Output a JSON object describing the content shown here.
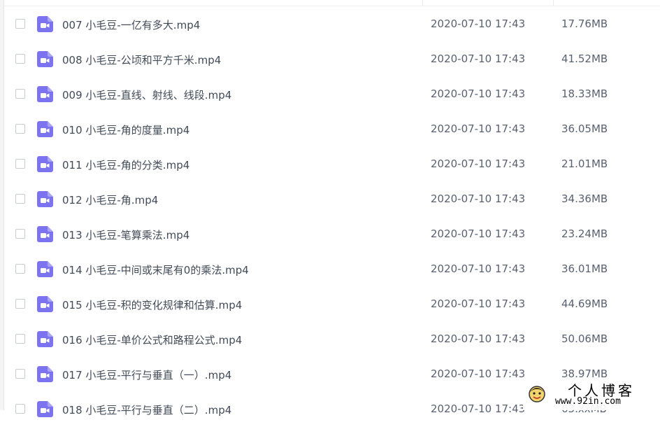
{
  "files": [
    {
      "name": "007 小毛豆-一亿有多大.mp4",
      "date": "2020-07-10 17:43",
      "size": "17.76MB"
    },
    {
      "name": "008 小毛豆-公顷和平方千米.mp4",
      "date": "2020-07-10 17:43",
      "size": "41.52MB"
    },
    {
      "name": "009 小毛豆-直线、射线、线段.mp4",
      "date": "2020-07-10 17:43",
      "size": "18.33MB"
    },
    {
      "name": "010 小毛豆-角的度量.mp4",
      "date": "2020-07-10 17:43",
      "size": "36.05MB"
    },
    {
      "name": "011 小毛豆-角的分类.mp4",
      "date": "2020-07-10 17:43",
      "size": "21.01MB"
    },
    {
      "name": "012 小毛豆-角.mp4",
      "date": "2020-07-10 17:43",
      "size": "34.36MB"
    },
    {
      "name": "013 小毛豆-笔算乘法.mp4",
      "date": "2020-07-10 17:43",
      "size": "23.24MB"
    },
    {
      "name": "014 小毛豆-中间或末尾有0的乘法.mp4",
      "date": "2020-07-10 17:43",
      "size": "36.01MB"
    },
    {
      "name": "015 小毛豆-积的变化规律和估算.mp4",
      "date": "2020-07-10 17:43",
      "size": "44.69MB"
    },
    {
      "name": "016 小毛豆-单价公式和路程公式.mp4",
      "date": "2020-07-10 17:43",
      "size": "50.06MB"
    },
    {
      "name": "017 小毛豆-平行与垂直（一）.mp4",
      "date": "2020-07-10 17:43",
      "size": "38.97MB"
    },
    {
      "name": "018 小毛豆-平行与垂直（二）.mp4",
      "date": "2020-07-10 17:43",
      "size": "63.xxMB"
    }
  ],
  "file_icon": "video-file-icon",
  "colors": {
    "file_icon": "#7b73f0",
    "row_hover": "#f7f8fb"
  },
  "watermark": {
    "title": "个人博客",
    "url": "www.92in.com"
  }
}
